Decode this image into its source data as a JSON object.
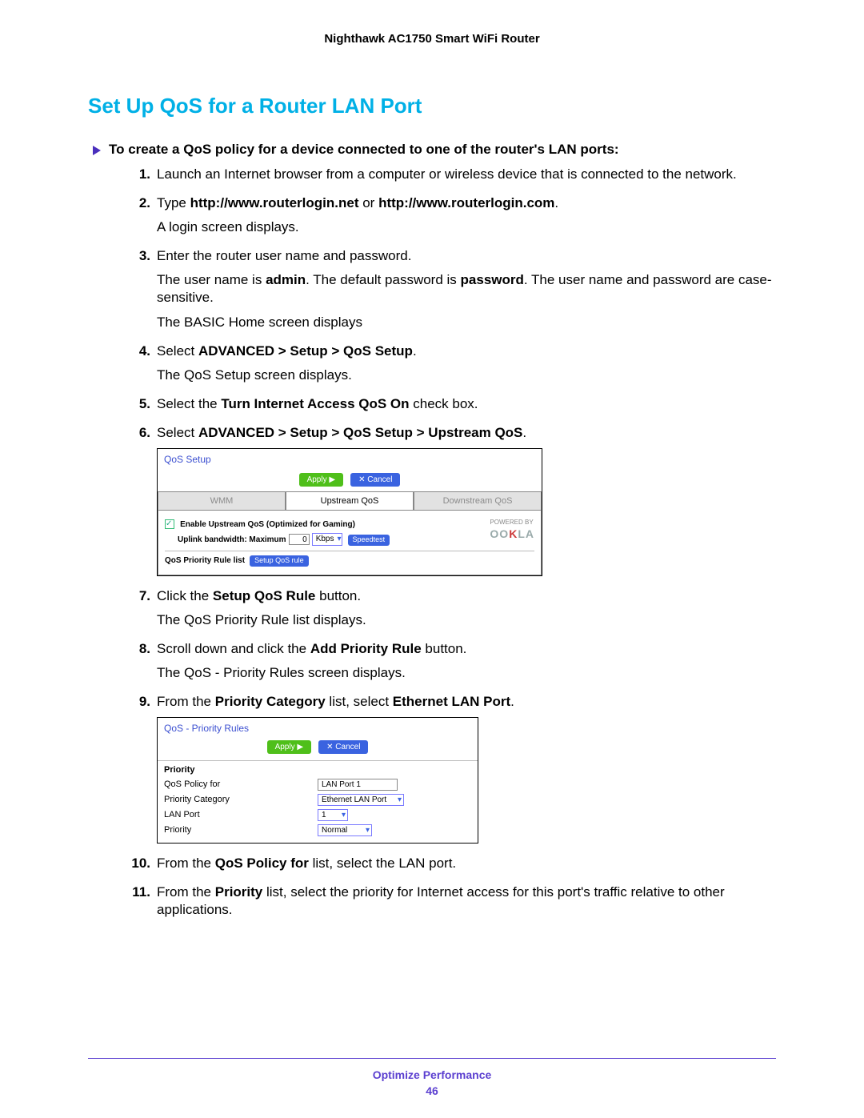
{
  "header": {
    "product": "Nighthawk AC1750 Smart WiFi Router"
  },
  "section_title": "Set Up QoS for a Router LAN Port",
  "lead": "To create a QoS policy for a device connected to one of the router's LAN ports:",
  "steps": {
    "s1": {
      "num": "1.",
      "p1": "Launch an Internet browser from a computer or wireless device that is connected to the network."
    },
    "s2": {
      "num": "2.",
      "pre": "Type ",
      "b1": "http://www.routerlogin.net",
      "mid": " or ",
      "b2": "http://www.routerlogin.com",
      "post": ".",
      "p2": "A login screen displays."
    },
    "s3": {
      "num": "3.",
      "p1": "Enter the router user name and password.",
      "p2a": "The user name is ",
      "p2b": "admin",
      "p2c": ". The default password is ",
      "p2d": "password",
      "p2e": ". The user name and password are case-sensitive.",
      "p3": "The BASIC Home screen displays"
    },
    "s4": {
      "num": "4.",
      "pre": "Select ",
      "b": "ADVANCED > Setup > QoS Setup",
      "post": ".",
      "p2": "The QoS Setup screen displays."
    },
    "s5": {
      "num": "5.",
      "pre": "Select the ",
      "b": "Turn Internet Access QoS On",
      "post": " check box."
    },
    "s6": {
      "num": "6.",
      "pre": "Select ",
      "b": "ADVANCED > Setup > QoS Setup > Upstream QoS",
      "post": "."
    },
    "s7": {
      "num": "7.",
      "pre": "Click the ",
      "b": "Setup QoS Rule",
      "post": " button.",
      "p2": "The QoS Priority Rule list displays."
    },
    "s8": {
      "num": "8.",
      "pre": "Scroll down and click the ",
      "b": "Add Priority Rule",
      "post": " button.",
      "p2": "The QoS - Priority Rules screen displays."
    },
    "s9": {
      "num": "9.",
      "pre": "From the ",
      "b": "Priority Category",
      "mid": " list, select ",
      "b2": "Ethernet LAN Port",
      "post": "."
    },
    "s10": {
      "num": "10.",
      "pre": "From the ",
      "b": "QoS Policy for",
      "post": " list, select the LAN port."
    },
    "s11": {
      "num": "11.",
      "pre": "From the ",
      "b": "Priority",
      "post": " list, select the priority for Internet access for this port's traffic relative to other applications."
    }
  },
  "shot1": {
    "title": "QoS Setup",
    "apply": "Apply ▶",
    "cancel": "✕ Cancel",
    "tabs": {
      "wmm": "WMM",
      "up": "Upstream QoS",
      "down": "Downstream QoS"
    },
    "enable": "Enable Upstream QoS (Optimized for Gaming)",
    "uplink_label": "Uplink bandwidth: Maximum",
    "uplink_value": "0",
    "uplink_unit": "Kbps",
    "speedtest": "Speedtest",
    "powered": "POWERED BY",
    "ookla_a": "OO",
    "ookla_k": "K",
    "ookla_b": "LA",
    "rulelist": "QoS Priority Rule list",
    "setup_rule": "Setup QoS rule"
  },
  "shot2": {
    "title": "QoS - Priority Rules",
    "apply": "Apply ▶",
    "cancel": "✕ Cancel",
    "priority_hdr": "Priority",
    "rows": {
      "policy_for_l": "QoS Policy for",
      "policy_for_v": "LAN Port 1",
      "cat_l": "Priority Category",
      "cat_v": "Ethernet LAN Port",
      "lanport_l": "LAN Port",
      "lanport_v": "1",
      "priority_l": "Priority",
      "priority_v": "Normal"
    }
  },
  "footer": {
    "text": "Optimize Performance",
    "page": "46"
  }
}
